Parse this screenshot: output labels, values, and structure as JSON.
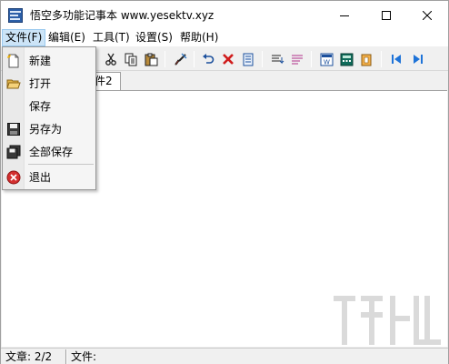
{
  "window": {
    "title": "悟空多功能记事本 www.yesektv.xyz"
  },
  "menubar": {
    "items": [
      {
        "label": "文件(F)"
      },
      {
        "label": "编辑(E)"
      },
      {
        "label": "工具(T)"
      },
      {
        "label": "设置(S)"
      },
      {
        "label": "帮助(H)"
      }
    ]
  },
  "file_menu": {
    "items": [
      {
        "label": "新建",
        "icon": "new-document-icon"
      },
      {
        "label": "打开",
        "icon": "open-folder-icon"
      },
      {
        "label": "保存",
        "icon": ""
      },
      {
        "label": "另存为",
        "icon": "floppy-disk-icon"
      },
      {
        "label": "全部保存",
        "icon": "save-all-icon"
      },
      {
        "label": "退出",
        "icon": "exit-icon"
      }
    ]
  },
  "tabs": [
    {
      "label": "件2"
    }
  ],
  "statusbar": {
    "article": "文章: 2/2",
    "file": "文件:"
  },
  "colors": {
    "menu_highlight": "#cce4f7",
    "exit_red": "#d32f2f",
    "nav_blue": "#1e73d8"
  }
}
